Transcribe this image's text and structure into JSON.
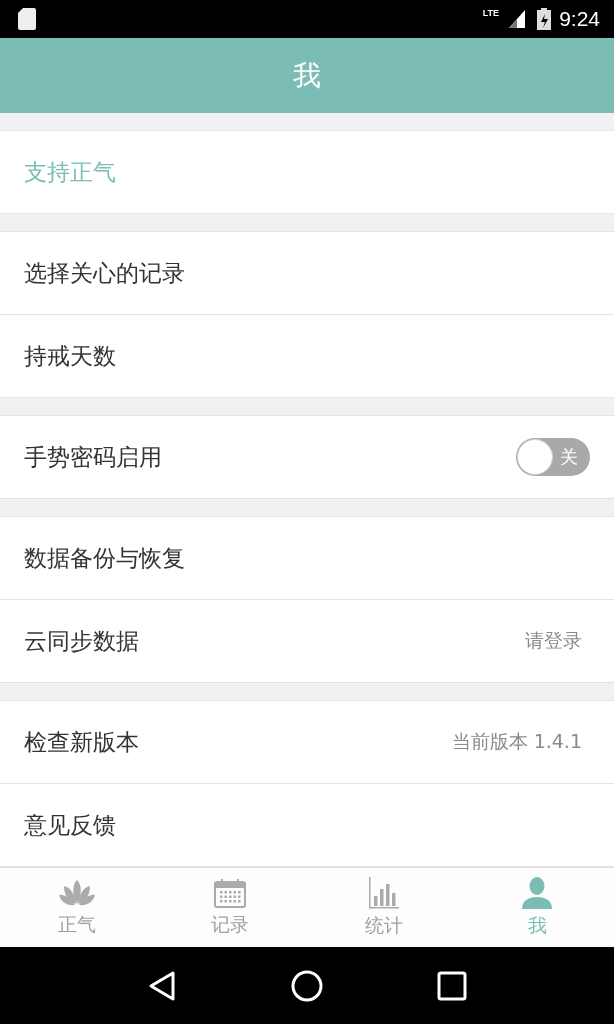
{
  "status_bar": {
    "network": "LTE",
    "time": "9:24"
  },
  "app_bar": {
    "title": "我"
  },
  "sections": [
    {
      "rows": [
        {
          "kind": "accent",
          "label": "支持正气"
        }
      ]
    },
    {
      "rows": [
        {
          "kind": "link",
          "label": "选择关心的记录"
        },
        {
          "kind": "link",
          "label": "持戒天数"
        }
      ]
    },
    {
      "rows": [
        {
          "kind": "toggle",
          "label": "手势密码启用",
          "on": false,
          "state_label": "关"
        }
      ]
    },
    {
      "rows": [
        {
          "kind": "link",
          "label": "数据备份与恢复"
        },
        {
          "kind": "value",
          "label": "云同步数据",
          "value": "请登录"
        }
      ]
    },
    {
      "rows": [
        {
          "kind": "value",
          "label": "检查新版本",
          "value": "当前版本 1.4.1"
        },
        {
          "kind": "link",
          "label": "意见反馈"
        }
      ]
    }
  ],
  "tabs": [
    {
      "label": "正气",
      "selected": false
    },
    {
      "label": "记录",
      "selected": false
    },
    {
      "label": "统计",
      "selected": false
    },
    {
      "label": "我",
      "selected": true
    }
  ]
}
